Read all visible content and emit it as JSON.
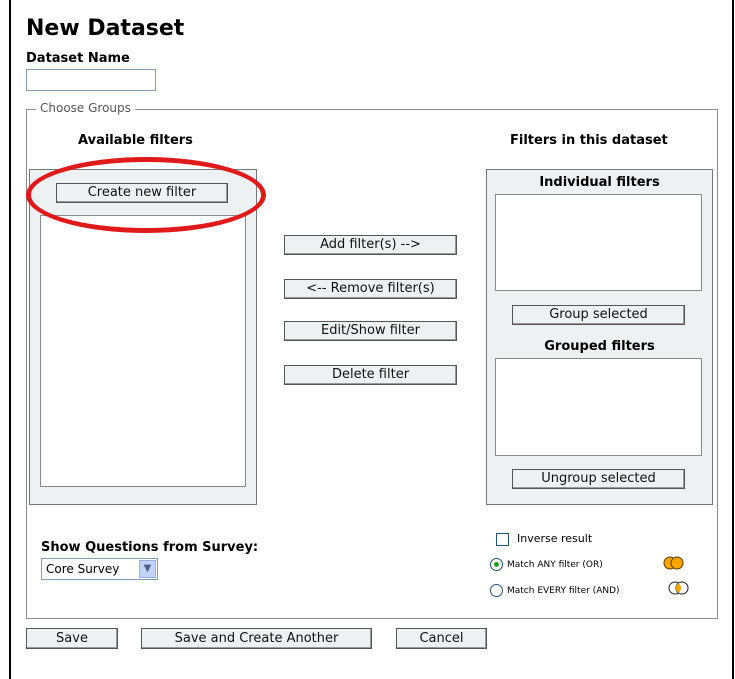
{
  "page": {
    "title": "New Dataset",
    "dataset_name_label": "Dataset Name",
    "dataset_name_value": ""
  },
  "groups": {
    "legend": "Choose Groups",
    "available_heading": "Available filters",
    "create_new_filter": "Create new filter",
    "in_dataset_heading": "Filters in this dataset",
    "individual_heading": "Individual filters",
    "grouped_heading": "Grouped filters",
    "group_selected": "Group selected",
    "ungroup_selected": "Ungroup selected"
  },
  "actions": {
    "add": "Add filter(s) -->",
    "remove": "<-- Remove filter(s)",
    "edit": "Edit/Show filter",
    "delete": "Delete filter"
  },
  "survey": {
    "label": "Show Questions from Survey:",
    "selected": "Core Survey"
  },
  "options": {
    "inverse": "Inverse result",
    "match_any": "Match ANY filter (OR)",
    "match_every": "Match EVERY filter (AND)",
    "match_any_selected": true
  },
  "footer": {
    "save": "Save",
    "save_another": "Save and Create Another",
    "cancel": "Cancel"
  },
  "colors": {
    "highlight": "#e01a1a",
    "venn_or": "#f7a600",
    "panel_bg": "#edf1f1"
  }
}
